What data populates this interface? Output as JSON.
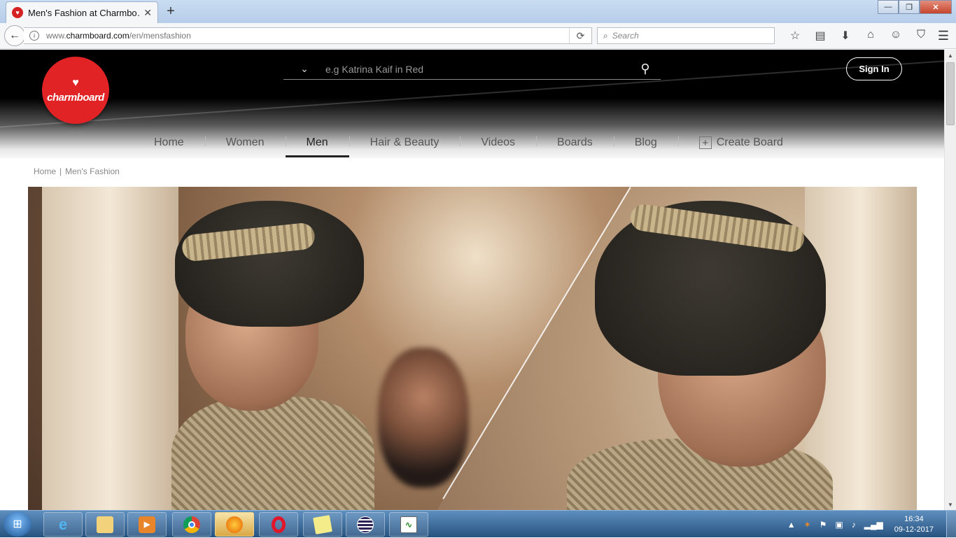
{
  "browser": {
    "tab_title": "Men's Fashion at Charmbo…",
    "tab_close": "✕",
    "new_tab": "+",
    "url_prefix": "www.",
    "url_domain": "charmboard.com",
    "url_path": "/en/mensfashion",
    "search_placeholder": "Search",
    "window_minimize": "—",
    "window_maximize": "❐",
    "window_close": "✕"
  },
  "site": {
    "logo_text": "charmboard",
    "search_placeholder": "e.g Katrina Kaif in Red",
    "signin_label": "Sign In",
    "nav": [
      {
        "label": "Home"
      },
      {
        "label": "Women"
      },
      {
        "label": "Men"
      },
      {
        "label": "Hair & Beauty"
      },
      {
        "label": "Videos"
      },
      {
        "label": "Boards"
      },
      {
        "label": "Blog"
      },
      {
        "label": "Create Board"
      }
    ],
    "active_nav": "Men",
    "breadcrumb": {
      "home": "Home",
      "separator": "|",
      "current": "Men's Fashion"
    }
  },
  "taskbar": {
    "clock_time": "16:34",
    "clock_date": "09-12-2017"
  },
  "colors": {
    "brand_red": "#e22326",
    "header_black": "#000000",
    "taskbar_blue": "#27527f"
  }
}
